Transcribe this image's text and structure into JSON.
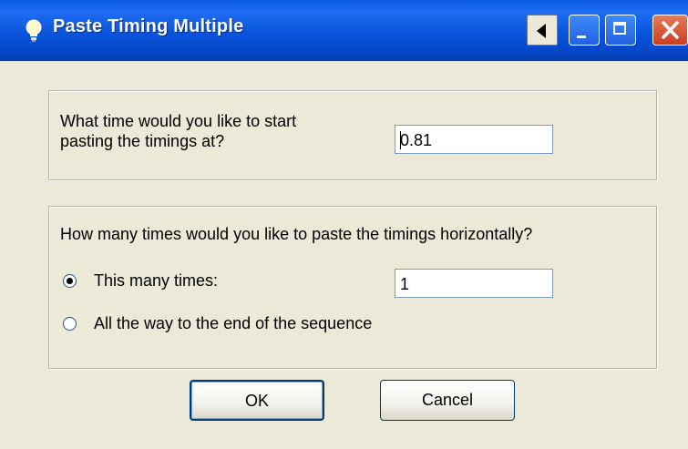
{
  "window": {
    "title": "Paste Timing Multiple"
  },
  "start_group": {
    "prompt_line1": "What time would you like to start",
    "prompt_line2": "pasting the timings at?",
    "start_time_value": "0.81"
  },
  "repeat_group": {
    "prompt": "How many times would you like to paste the timings horizontally?",
    "option_this_many_label": "This many times:",
    "option_this_many_selected": true,
    "times_value": "1",
    "option_to_end_label": "All the way to the end of the sequence",
    "option_to_end_selected": false
  },
  "buttons": {
    "ok_label": "OK",
    "cancel_label": "Cancel"
  },
  "colors": {
    "titlebar": "#0a54dc",
    "dialog_bg": "#ece9d8",
    "close_button": "#c8401e"
  },
  "icons": {
    "title": "bulb-icon",
    "help": "left-triangle-icon",
    "minimize": "minimize-icon",
    "maximize": "maximize-icon",
    "close": "close-icon"
  }
}
